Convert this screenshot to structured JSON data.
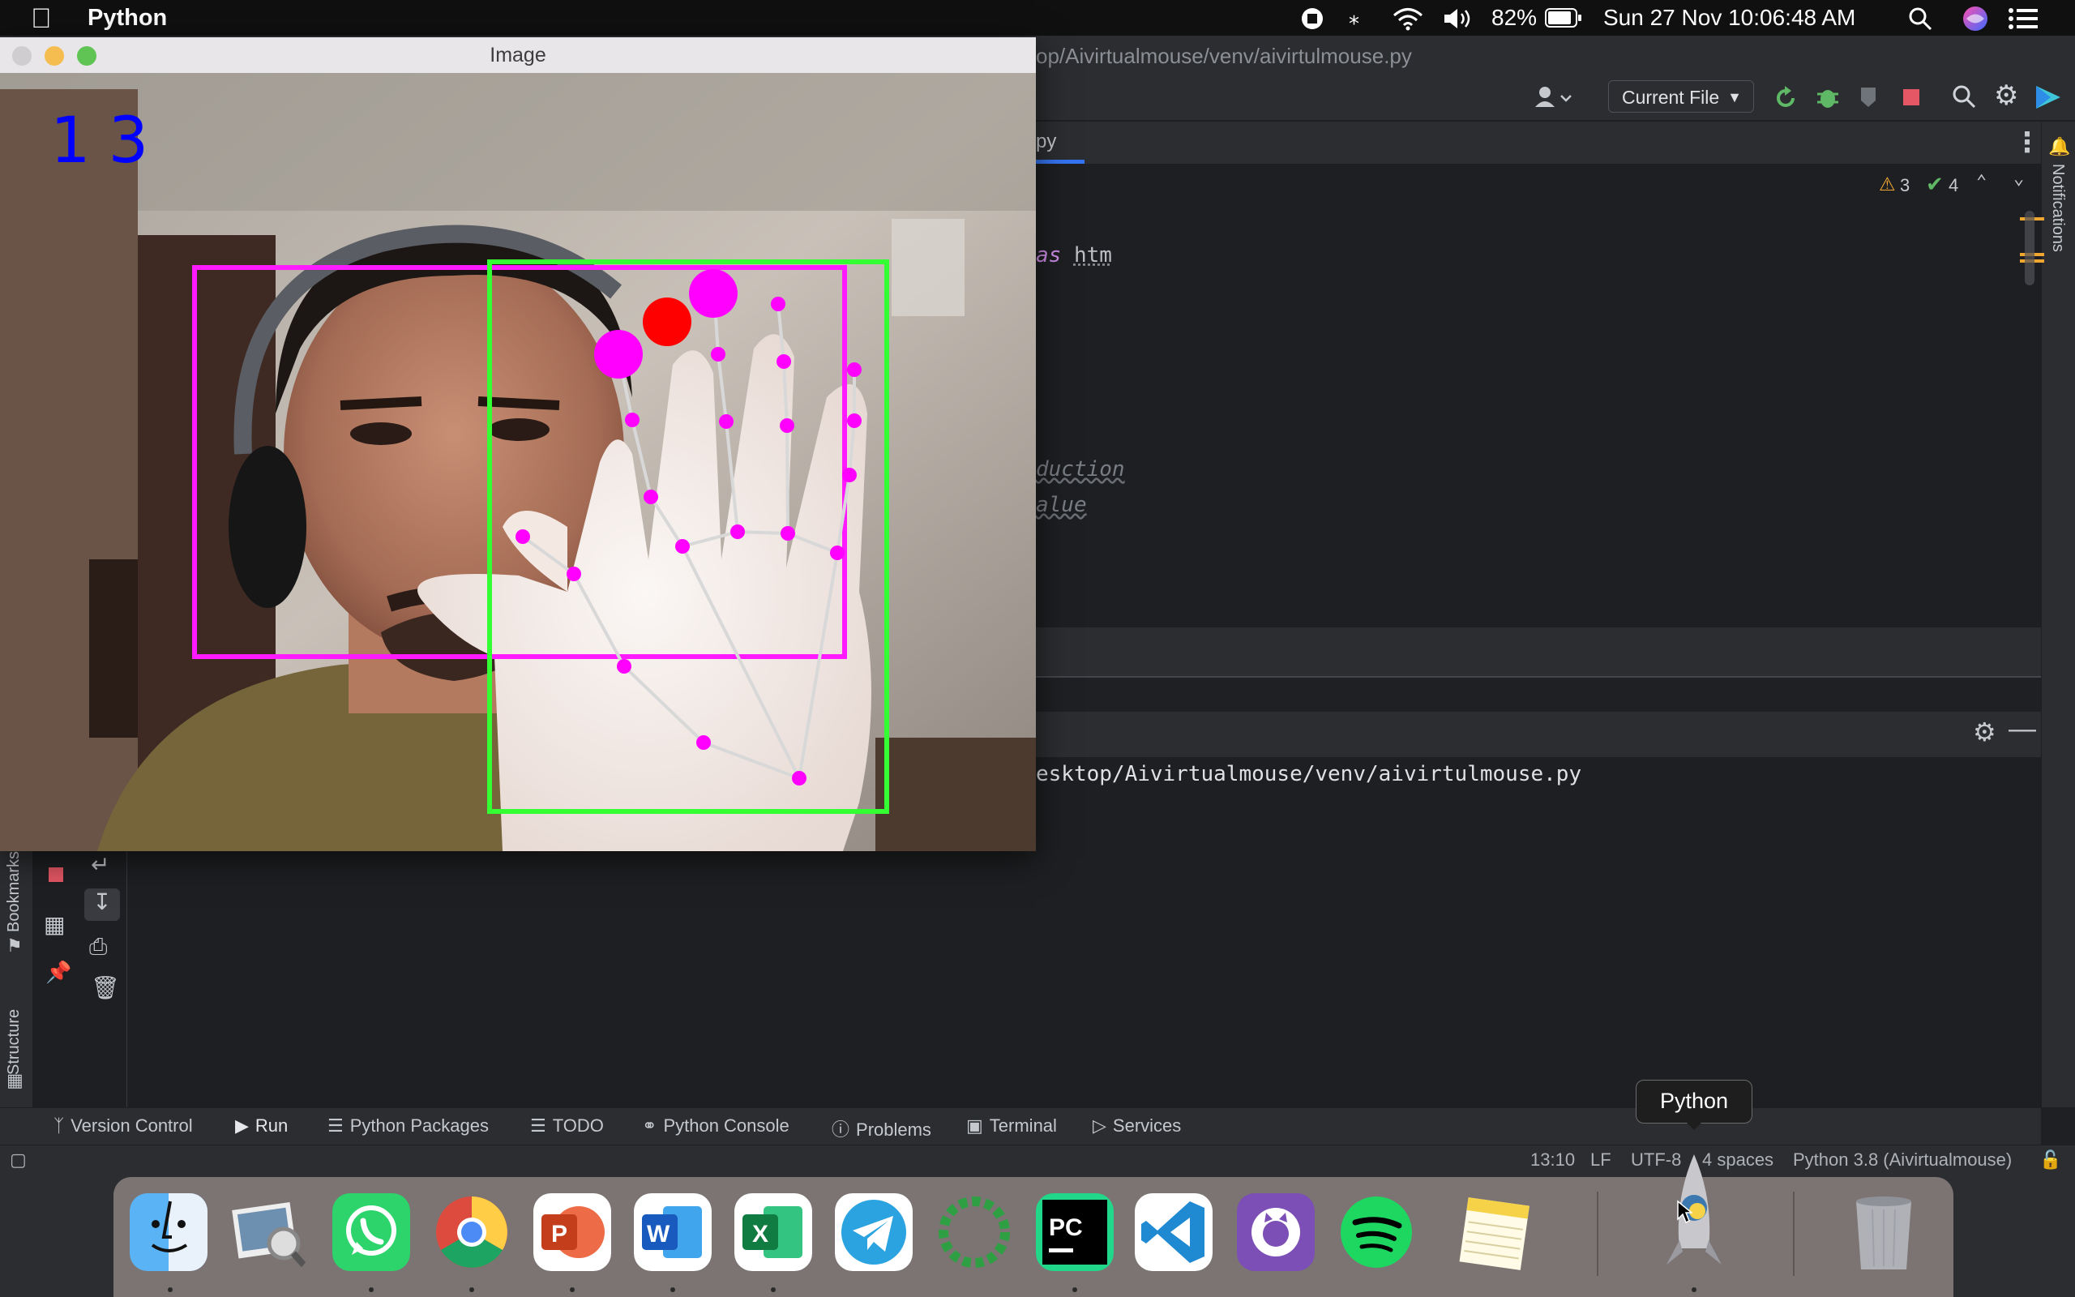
{
  "menubar": {
    "app_name": "Python",
    "battery": "82%",
    "datetime": "Sun 27 Nov  10:06:48 AM"
  },
  "ide": {
    "title_path": "op/Aivirtualmouse/venv/aivirtulmouse.py",
    "run_config": "Current File",
    "tab_label": "py",
    "warnings": "3",
    "checks": "4",
    "code_lines": [
      "as",
      "htm",
      "duction",
      "alue"
    ],
    "run_output_path": "esktop/Aivirtualmouse/venv/aivirtulmouse.py",
    "left_stripe": {
      "bookmarks": "Bookmarks",
      "structure": "Structure"
    },
    "right_stripe": "Notifications",
    "tool_windows": [
      "Version Control",
      "Run",
      "Python Packages",
      "TODO",
      "Python Console",
      "Problems",
      "Terminal",
      "Services"
    ],
    "status": {
      "position": "13:10",
      "line_sep": "LF",
      "encoding": "UTF-8",
      "indent": "4 spaces",
      "interpreter": "Python 3.8 (Aivirtualmouse)"
    }
  },
  "image_window": {
    "title": "Image",
    "fps_overlay": "13",
    "colors": {
      "frame_box": "#ff1aff",
      "active_box": "#33ff33",
      "landmark": "#ff00ff",
      "click_point": "#ff0000",
      "fps_text": "#0000ff"
    }
  },
  "dock": {
    "apps": [
      "Finder",
      "Preview",
      "WhatsApp",
      "Google Chrome",
      "PowerPoint",
      "Word",
      "Excel",
      "Telegram",
      "Loading",
      "PyCharm",
      "VS Code",
      "GitHub Desktop",
      "Spotify",
      "Notes",
      "Python",
      "Trash"
    ],
    "tooltip": "Python"
  }
}
